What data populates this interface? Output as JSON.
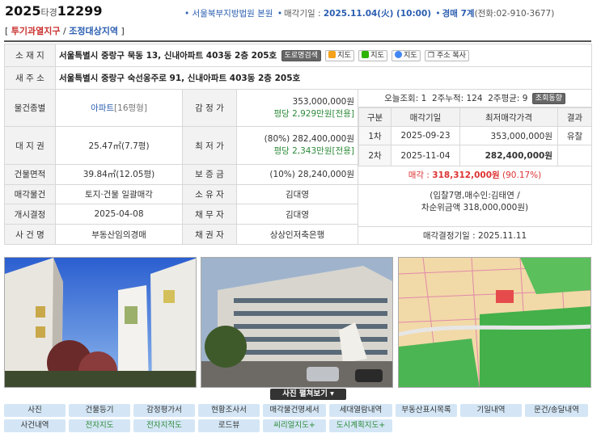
{
  "header": {
    "year": "2025",
    "type": "타경",
    "number": "12299",
    "court": "서울북부지방법원 본원",
    "sale_date_label": "매각기일 :",
    "sale_date": "2025.11.04(火) (10:00)",
    "dept": "경매 7계",
    "phone": "(전화:02-910-3677)"
  },
  "tags": {
    "open": "[",
    "tag1": "투기과열지구",
    "slash": " / ",
    "tag2": "조정대상지역",
    "close": "]"
  },
  "info": {
    "address_label": "소 재 지",
    "address": "서울특별시 중랑구 묵동 13, 신내아파트 403동 2층 205호",
    "road_search": "도로명검색",
    "map_d": "지도",
    "map_n": "지도",
    "map_g": "지도",
    "copy_addr": "주소 복사",
    "new_addr_label": "새 주 소",
    "new_addr": "서울특별시 중랑구 숙선옹주로 91, 신내아파트 403동 2층 205호",
    "type_label": "물건종별",
    "type_value": "아파트",
    "type_size": "[16평형]",
    "appraisal_label": "감 정 가",
    "appraisal": "353,000,000원",
    "appraisal_pp": "평당 2,929만원[전용]",
    "land_label": "대 지 권",
    "land": "25.47㎡(7.7평)",
    "min_label": "최 저 가",
    "min": "(80%) 282,400,000원",
    "min_pp": "평당 2,343만원[전용]",
    "bldg_label": "건물면적",
    "bldg": "39.84㎡(12.05평)",
    "deposit_label": "보 증 금",
    "deposit": "(10%) 28,240,000원",
    "sale_obj_label": "매각물건",
    "sale_obj": "토지·건물 일괄매각",
    "owner_label": "소 유 자",
    "owner": "김대영",
    "start_label": "개시결정",
    "start": "2025-04-08",
    "debtor_label": "채 무 자",
    "debtor": "김대영",
    "case_label": "사 건 명",
    "case_name": "부동산임의경매",
    "creditor_label": "채 권 자",
    "creditor": "상상인저축은행"
  },
  "panel": {
    "views_today": "오늘조회: 1",
    "views_2w": "2주누적: 124",
    "views_avg": "2주평균: 9",
    "view_trend": "조회동향",
    "col_round": "구분",
    "col_date": "매각기일",
    "col_min": "최저매각가격",
    "col_result": "결과",
    "rounds": [
      {
        "round": "1차",
        "date": "2025-09-23",
        "price": "353,000,000원",
        "result": "유찰"
      },
      {
        "round": "2차",
        "date": "2025-11-04",
        "price": "282,400,000원",
        "result": ""
      }
    ],
    "sold_label": "매각 :",
    "sold_price": "318,312,000원",
    "sold_pct": "(90.17%)",
    "bid_info": "(입찰7명,매수인:김태연 /",
    "bid_info2": "차순위금액 318,000,000원)",
    "decision": "매각결정기일 : 2025.11.11"
  },
  "photos_toggle": "사진 펼쳐보기",
  "buttons_row1": [
    "사진",
    "건물등기",
    "감정평가서",
    "현황조사서",
    "매각물건명세서",
    "세대열람내역",
    "부동산표시목록",
    "기일내역",
    "문건/송달내역"
  ],
  "buttons_row2": [
    "사건내역",
    "전자지도",
    "전자지적도",
    "로드뷰",
    "씨리얼지도+",
    "도시계획지도+"
  ],
  "colors": {
    "blue": "#2a5db0",
    "red": "#d33333",
    "green": "#2e8b3a",
    "button_bg": "#d4e6f5"
  }
}
